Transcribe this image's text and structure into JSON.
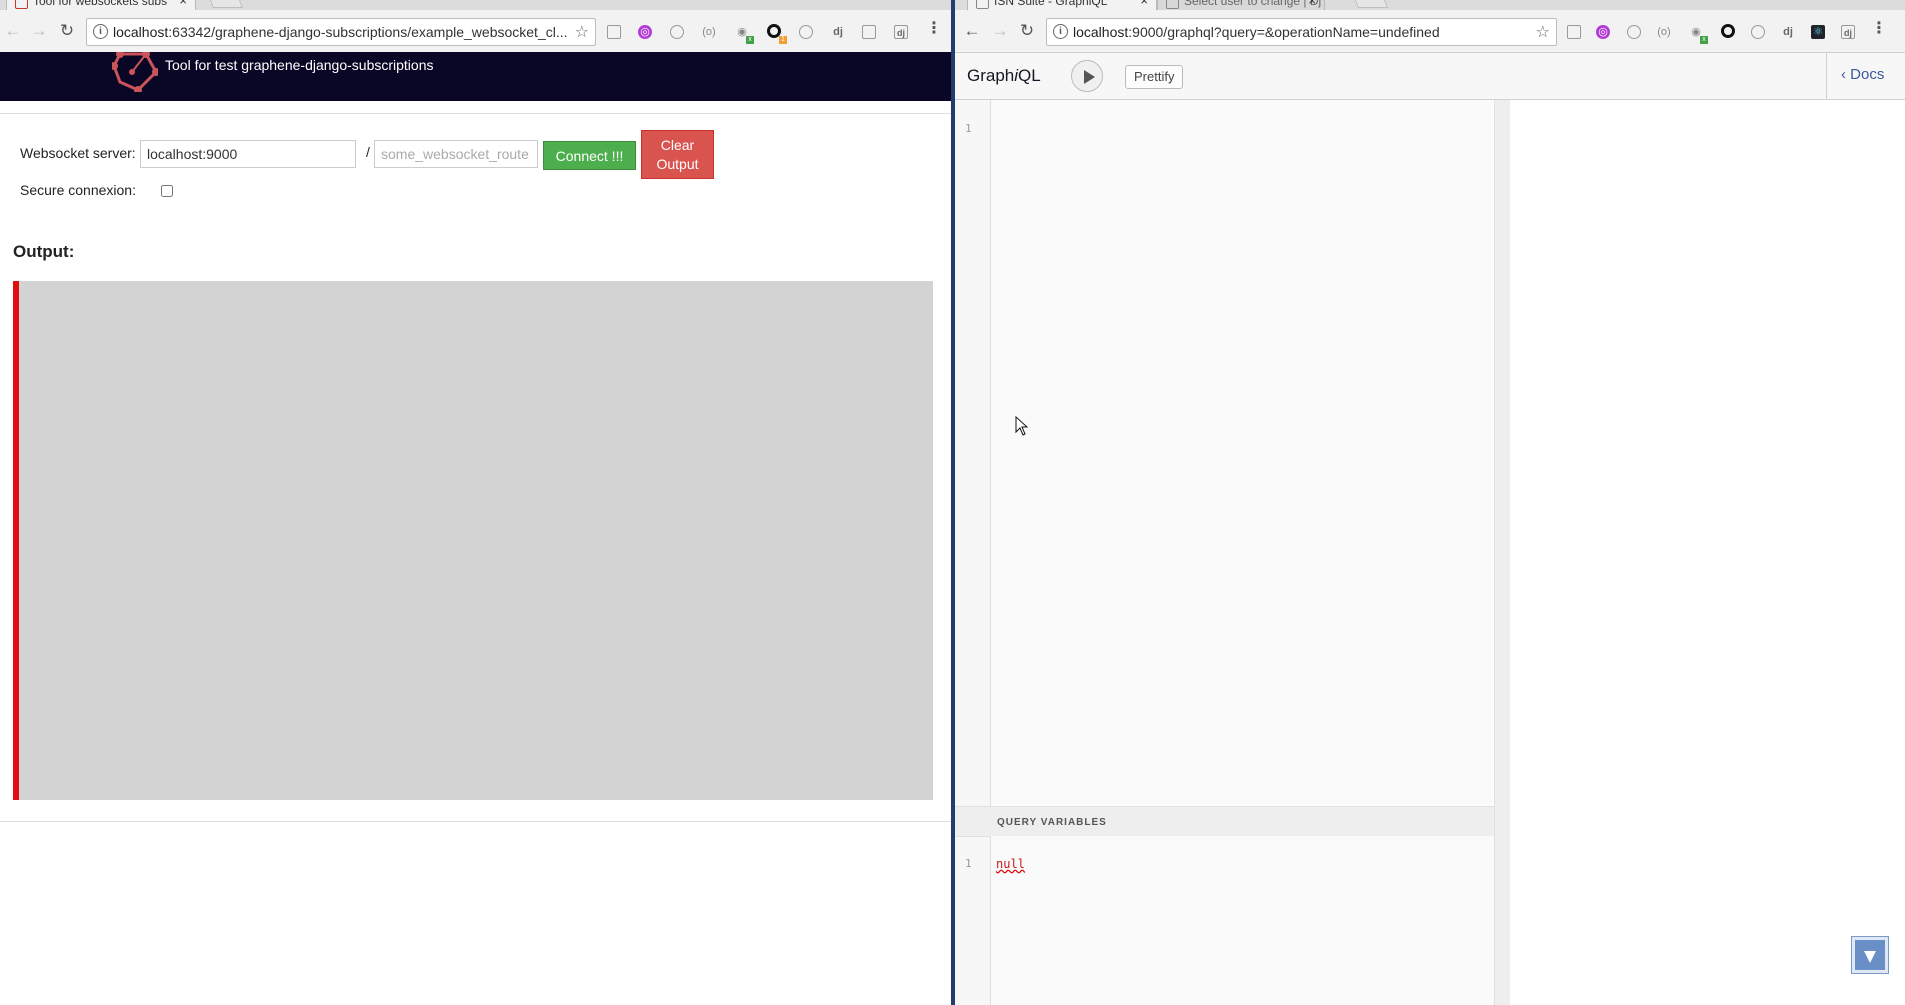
{
  "left_window": {
    "tab": {
      "title": "Tool for websockets subs"
    },
    "url": {
      "host": "localhost",
      "rest": ":63342/graphene-django-subscriptions/example_websocket_cl..."
    },
    "header": {
      "title": "Tool for test graphene-django-subscriptions"
    },
    "form": {
      "server_label": "Websocket server:",
      "server_value": "localhost:9000",
      "separator": "/",
      "route_placeholder": "some_websocket_route",
      "connect_label": "Connect !!!",
      "clear_label": "Clear Output",
      "secure_label": "Secure connexion:",
      "secure_checked": false
    },
    "output": {
      "heading": "Output:",
      "accent_color": "#e01010",
      "background": "#d3d3d3"
    },
    "extensions": [
      "tab-icon",
      "graphql-icon",
      "circle-icon",
      "code-icon",
      "globe-icon",
      "ring-icon",
      "target-icon",
      "dj-icon",
      "box-icon",
      "dj-box-icon",
      "menu-icon"
    ]
  },
  "right_window": {
    "tabs": [
      {
        "title": "ISN Suite - GraphiQL",
        "active": true
      },
      {
        "title": "Select user to change | Dj",
        "active": false
      }
    ],
    "url": {
      "host": "localhost",
      "rest": ":9000/graphql?query=&operationName=undefined"
    },
    "graphiql": {
      "title_prefix": "Graph",
      "title_i": "i",
      "title_suffix": "QL",
      "prettify_label": "Prettify",
      "docs_label": "Docs",
      "editor_line": "1",
      "variables_title": "QUERY VARIABLES",
      "variables_line": "1",
      "variables_value": "null"
    }
  },
  "colors": {
    "header_bg": "#0a0626",
    "connect": "#4cae4c",
    "clear": "#d9534f",
    "divider": "#233e6e"
  }
}
